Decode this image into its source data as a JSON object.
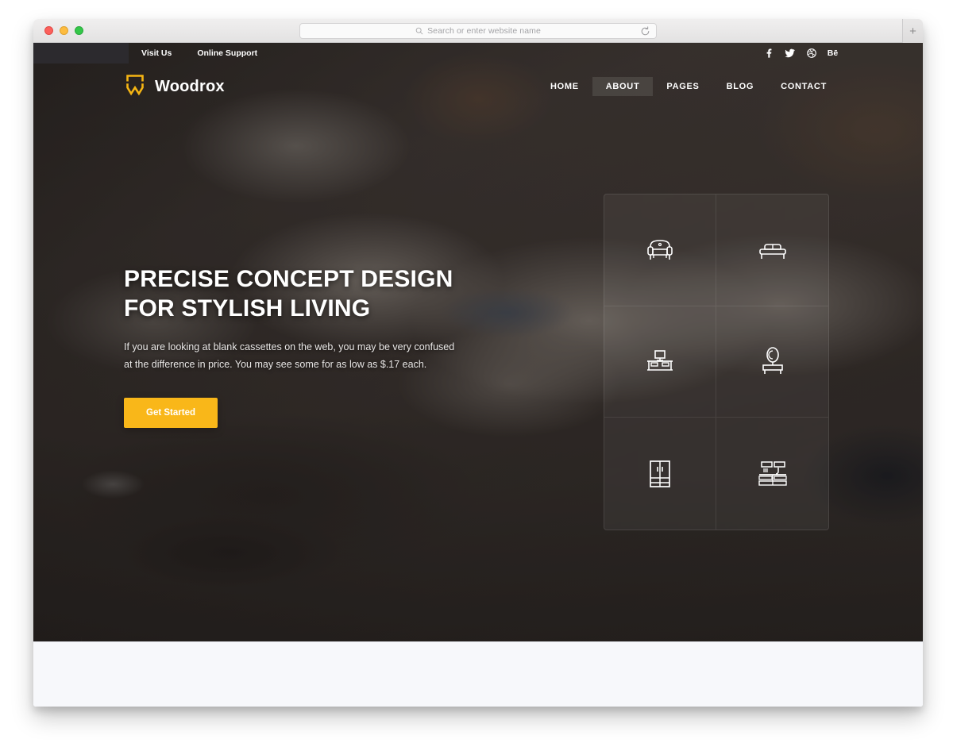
{
  "browser": {
    "traffic_lights": [
      "close",
      "minimize",
      "maximize"
    ],
    "address_placeholder": "Search or enter website name",
    "address_value": "",
    "search_icon": "search-icon",
    "reload_icon": "reload-icon",
    "new_tab_label": "+"
  },
  "site": {
    "topbar": {
      "links": [
        {
          "label": "Visit Us"
        },
        {
          "label": "Online Support"
        }
      ],
      "socials": [
        {
          "name": "facebook",
          "glyph": "f"
        },
        {
          "name": "twitter",
          "glyph": ""
        },
        {
          "name": "dribbble",
          "glyph": ""
        },
        {
          "name": "behance",
          "glyph": "Bē"
        }
      ]
    },
    "brand": {
      "name": "Woodrox",
      "logo_icon": "woodrox-w-mark",
      "logo_color": "#f5b513"
    },
    "nav": [
      {
        "label": "HOME",
        "active": false
      },
      {
        "label": "ABOUT",
        "active": true
      },
      {
        "label": "PAGES",
        "active": false
      },
      {
        "label": "BLOG",
        "active": false
      },
      {
        "label": "CONTACT",
        "active": false
      }
    ],
    "hero": {
      "title_line1": "PRECISE CONCEPT DESIGN",
      "title_line2": "FOR STYLISH LIVING",
      "paragraph": "If you are looking at blank cassettes on the web, you may be very confused at the difference in price. You may see some for as low as $.17 each.",
      "cta_label": "Get Started",
      "cta_color": "#f9b719"
    },
    "categories": [
      {
        "name": "armchair",
        "icon": "armchair-icon"
      },
      {
        "name": "bed",
        "icon": "bed-icon"
      },
      {
        "name": "office-desk",
        "icon": "desk-icon"
      },
      {
        "name": "dressing-table",
        "icon": "dressing-table-icon"
      },
      {
        "name": "wardrobe",
        "icon": "wardrobe-icon"
      },
      {
        "name": "kitchen",
        "icon": "kitchen-icon"
      }
    ]
  }
}
